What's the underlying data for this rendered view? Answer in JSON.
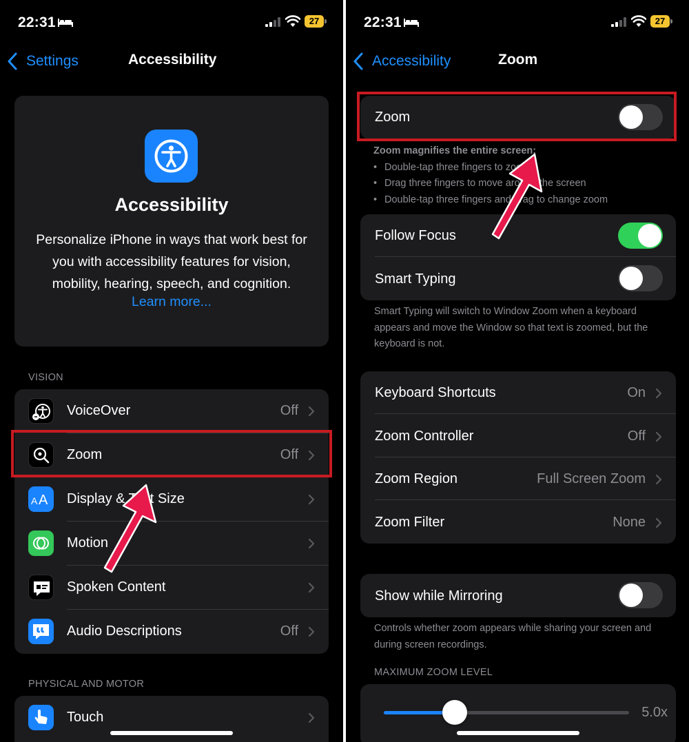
{
  "left": {
    "status": {
      "time": "22:31",
      "battery": "27"
    },
    "nav": {
      "back_label": "Settings",
      "title": "Accessibility"
    },
    "hero": {
      "title": "Accessibility",
      "description": "Personalize iPhone in ways that work best for you with accessibility features for vision, mobility, hearing, speech, and cognition.",
      "link": "Learn more..."
    },
    "vision_header": "VISION",
    "vision_rows": [
      {
        "label": "VoiceOver",
        "value": "Off",
        "icon": "voiceover-icon",
        "icon_bg": "#000000"
      },
      {
        "label": "Zoom",
        "value": "Off",
        "icon": "zoom-icon",
        "icon_bg": "#000000"
      },
      {
        "label": "Display & Text Size",
        "value": "",
        "icon": "text-size-icon",
        "icon_bg": "#1a84ff"
      },
      {
        "label": "Motion",
        "value": "",
        "icon": "motion-icon",
        "icon_bg": "#34c759"
      },
      {
        "label": "Spoken Content",
        "value": "",
        "icon": "spoken-content-icon",
        "icon_bg": "#000000"
      },
      {
        "label": "Audio Descriptions",
        "value": "Off",
        "icon": "audio-descriptions-icon",
        "icon_bg": "#1a84ff"
      }
    ],
    "motor_header": "PHYSICAL AND MOTOR",
    "motor_rows": [
      {
        "label": "Touch",
        "value": "",
        "icon": "touch-icon",
        "icon_bg": "#1a84ff"
      }
    ]
  },
  "right": {
    "status": {
      "time": "22:31",
      "battery": "27"
    },
    "nav": {
      "back_label": "Accessibility",
      "title": "Zoom"
    },
    "zoom_toggle": {
      "label": "Zoom",
      "state": "off"
    },
    "zoom_description": {
      "title": "Zoom magnifies the entire screen:",
      "items": [
        "Double-tap three fingers to zoom",
        "Drag three fingers to move around the screen",
        "Double-tap three fingers and drag to change zoom"
      ]
    },
    "focus_group": [
      {
        "label": "Follow Focus",
        "state": "on"
      },
      {
        "label": "Smart Typing",
        "state": "off"
      }
    ],
    "smart_typing_footer": "Smart Typing will switch to Window Zoom when a keyboard appears and move the Window so that text is zoomed, but the keyboard is not.",
    "settings_group": [
      {
        "label": "Keyboard Shortcuts",
        "value": "On"
      },
      {
        "label": "Zoom Controller",
        "value": "Off"
      },
      {
        "label": "Zoom Region",
        "value": "Full Screen Zoom"
      },
      {
        "label": "Zoom Filter",
        "value": "None"
      }
    ],
    "mirroring": {
      "label": "Show while Mirroring",
      "state": "off"
    },
    "mirroring_footer": "Controls whether zoom appears while sharing your screen and during screen recordings.",
    "max_zoom_header": "MAXIMUM ZOOM LEVEL",
    "max_zoom": {
      "value_label": "5.0x",
      "fraction": 0.29
    }
  },
  "colors": {
    "accent": "#1f8fff",
    "highlight": "#c71b22",
    "arrow": "#e8194b",
    "toggle_on": "#30d158"
  }
}
